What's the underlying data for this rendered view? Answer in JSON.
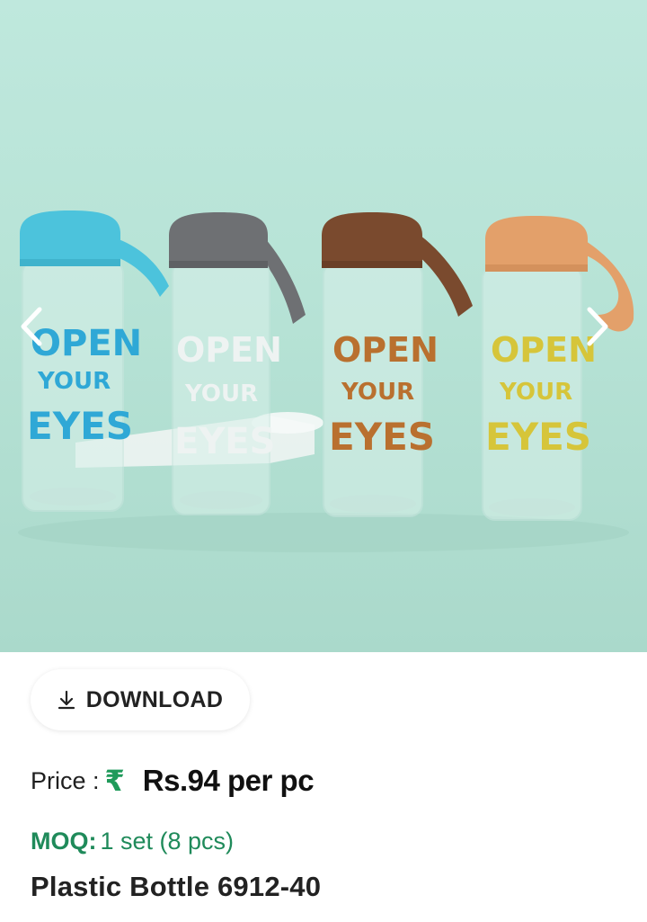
{
  "gallery": {
    "prev_icon": "chevron-left-icon",
    "next_icon": "chevron-right-icon",
    "bottle_text": [
      "OPEN",
      "YOUR",
      "EYES"
    ],
    "colors": {
      "background": "#b7e3d6",
      "cap_blue": "#4cc3dc",
      "cap_grey": "#6e7073",
      "cap_brown": "#7a4a2e",
      "cap_orange": "#e3a06a",
      "text_blue": "#2fa8d6",
      "text_white": "#eef3f2",
      "text_brown": "#b9702f",
      "text_yellow": "#d6c53a"
    }
  },
  "download": {
    "label": "DOWNLOAD",
    "icon": "download-arrow-icon"
  },
  "price": {
    "label": "Price :",
    "currency_symbol": "₹",
    "value": "Rs.94 per pc",
    "accent": "#1f9a5a"
  },
  "moq": {
    "label": "MOQ:",
    "value": "1 set (8 pcs)",
    "color": "#1f8a5a"
  },
  "product": {
    "title": "Plastic Bottle 6912-40"
  }
}
